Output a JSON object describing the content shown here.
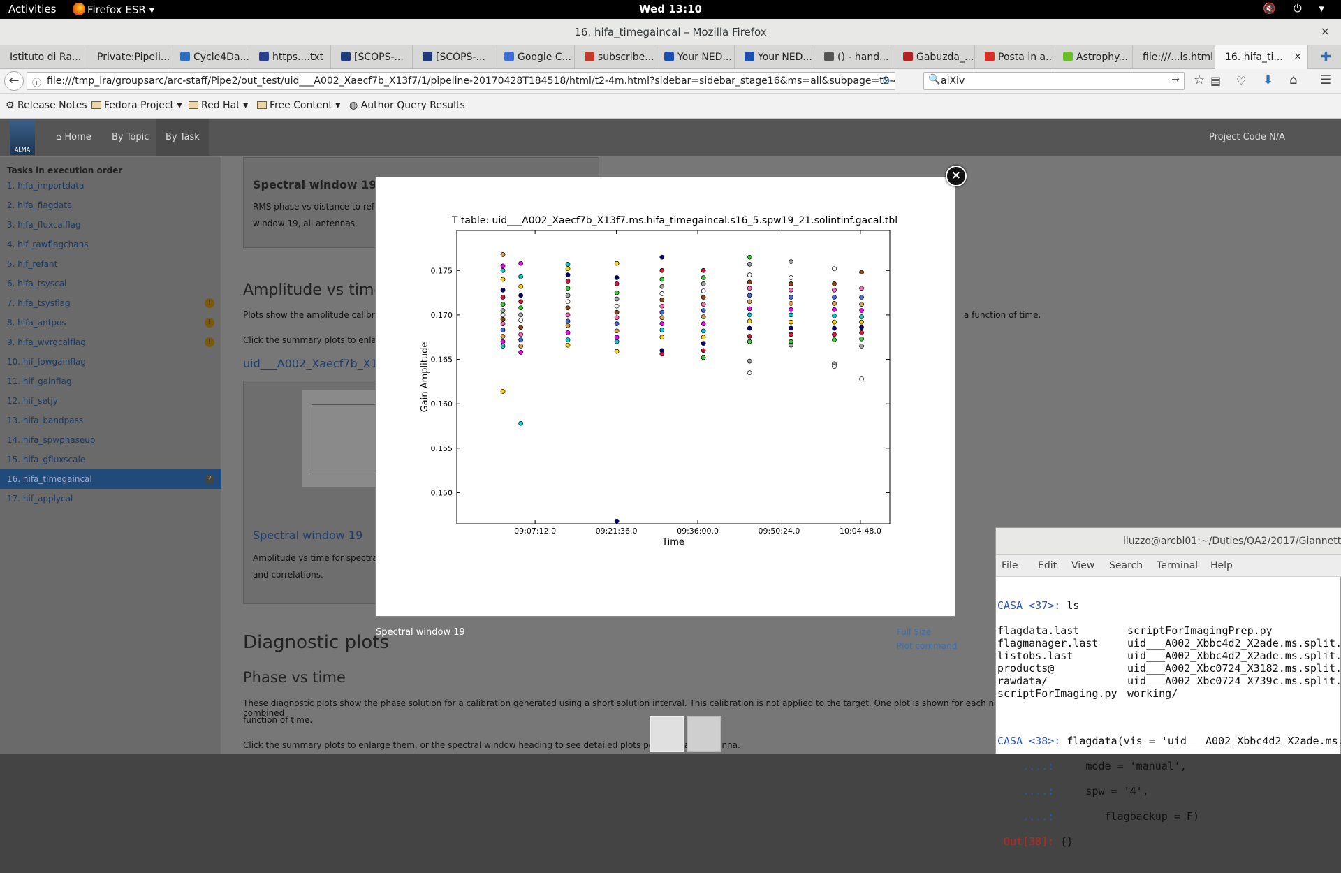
{
  "topbar": {
    "activities": "Activities",
    "app_menu": "Firefox ESR ▾",
    "clock": "Wed 13:10",
    "tray": "🔇 ⏻ ▾"
  },
  "window": {
    "title": "16. hifa_timegaincal – Mozilla Firefox",
    "close": "×"
  },
  "tabs": [
    {
      "label": "Istituto di Ra...",
      "color": ""
    },
    {
      "label": "Private:Pipeli...",
      "color": ""
    },
    {
      "label": "Cycle4Da...",
      "color": "#2a6ebd"
    },
    {
      "label": "https....txt",
      "color": "#2b3f8f"
    },
    {
      "label": "[SCOPS-...",
      "color": "#1f3a7a"
    },
    {
      "label": "[SCOPS-...",
      "color": "#1f3a7a"
    },
    {
      "label": "Google C...",
      "color": "#3b6fd6"
    },
    {
      "label": "subscribe...",
      "color": "#c03b2b"
    },
    {
      "label": "Your NED...",
      "color": "#1a4fb0"
    },
    {
      "label": "Your NED...",
      "color": "#1a4fb0"
    },
    {
      "label": "() - hand...",
      "color": "#555"
    },
    {
      "label": "Gabuzda_...",
      "color": "#b22222"
    },
    {
      "label": "Posta in a...",
      "color": "#d93025"
    },
    {
      "label": "Astrophy...",
      "color": "#6bbf2b"
    },
    {
      "label": "file:///...ls.html",
      "color": ""
    },
    {
      "label": "16. hifa_ti...",
      "color": "",
      "close": "×"
    }
  ],
  "nav": {
    "url": "file:///tmp_ira/groupsarc/arc-staff/Pipe2/out_test/uid___A002_Xaecf7b_X13f7/1/pipeline-20170428T184518/html/t2-4m.html?sidebar=sidebar_stage16&ms=all&subpage=t2-4m_",
    "search_value": "aiXiv"
  },
  "bookmarks": [
    "Release Notes",
    "Fedora Project",
    "Red Hat",
    "Free Content",
    "Author Query Results"
  ],
  "page_nav": {
    "logo": "ALMA",
    "home": "Home",
    "by_topic": "By Topic",
    "by_task": "By Task",
    "project_code": "Project Code N/A"
  },
  "sidebar": {
    "heading": "Tasks in execution order",
    "items": [
      "1. hifa_importdata",
      "2. hifa_flagdata",
      "3. hifa_fluxcalflag",
      "4. hif_rawflagchans",
      "5. hif_refant",
      "6. hifa_tsyscal",
      "7. hifa_tsysflag",
      "8. hifa_antpos",
      "9. hifa_wvrgcalflag",
      "10. hif_lowgainflag",
      "11. hif_gainflag",
      "12. hif_setjy",
      "13. hifa_bandpass",
      "14. hifa_spwphaseup",
      "15. hifa_gfluxscale",
      "16. hifa_timegaincal",
      "17. hif_applycal"
    ]
  },
  "content": {
    "spw_heading_top": "Spectral window 19",
    "spw_desc_top_1": "RMS phase vs distance to refer",
    "spw_desc_top_2": "window 19, all antennas.",
    "amp_heading": "Amplitude vs time",
    "amp_desc": "Plots show the amplitude calibra",
    "amp_desc_right": "a function of time.",
    "amp_click": "Click the summary plots to enlarg",
    "uid_link": "uid___A002_Xaecf7b_X1",
    "spw_link": "Spectral window 19",
    "spw_desc_1": "Amplitude vs time for spectral v",
    "spw_desc_2": "and correlations.",
    "diag_heading": "Diagnostic plots",
    "phase_heading": "Phase vs time",
    "phase_desc_1": "These diagnostic plots show the phase solution for a calibration generated using a short solution interval. This calibration is not applied to the target. One plot is shown for each non-combined",
    "phase_desc_2": "function of time.",
    "phase_click": "Click the summary plots to enlarge them, or the spectral window heading to see detailed plots per spec",
    "phase_click_tail": "and antenna."
  },
  "modal": {
    "close": "×",
    "caption": "Spectral window 19",
    "full_size": "Full Size",
    "plot_command": "Plot command"
  },
  "chart_data": {
    "type": "scatter",
    "title": "T table: uid___A002_Xaecf7b_X13f7.ms.hifa_timegaincal.s16_5.spw19_21.solintinf.gacal.tbl",
    "xlabel": "Time",
    "ylabel": "Gain Amplitude",
    "x_ticks": [
      "09:07:12.0",
      "09:21:36.0",
      "09:36:00.0",
      "09:50:24.0",
      "10:04:48.0"
    ],
    "y_ticks": [
      "0.150",
      "0.155",
      "0.160",
      "0.165",
      "0.170",
      "0.175"
    ],
    "ylim": [
      0.1465,
      0.1795
    ],
    "xlim_seconds": [
      32000,
      36600
    ],
    "grid": false,
    "scan_times": [
      "09:01:30",
      "09:04:40",
      "09:13:00",
      "09:21:40",
      "09:29:40",
      "09:37:00",
      "09:45:10",
      "09:52:30",
      "10:00:10",
      "10:05:00"
    ],
    "marker_colors": [
      "#d4a24a",
      "#ff00ff",
      "#00ced1",
      "#ffd700",
      "#000080",
      "#dc143c",
      "#32cd32",
      "#a0a0a0",
      "#ffffff",
      "#8b4513",
      "#ff69b4",
      "#4169e1"
    ],
    "points": [
      {
        "scan": 0,
        "values": [
          0.1768,
          0.1755,
          0.175,
          0.174,
          0.1728,
          0.172,
          0.1712,
          0.1705,
          0.17,
          0.1695,
          0.169,
          0.1683,
          0.1676,
          0.167,
          0.1665,
          0.1614
        ]
      },
      {
        "scan": 1,
        "values": [
          0.1758,
          0.1743,
          0.1732,
          0.1722,
          0.1715,
          0.1708,
          0.17,
          0.1694,
          0.1686,
          0.1678,
          0.1672,
          0.1665,
          0.1658,
          0.1578
        ]
      },
      {
        "scan": 2,
        "values": [
          0.1757,
          0.1752,
          0.1745,
          0.1738,
          0.173,
          0.1722,
          0.1715,
          0.1708,
          0.17,
          0.1693,
          0.1688,
          0.168,
          0.1672,
          0.1666
        ]
      },
      {
        "scan": 3,
        "values": [
          0.1758,
          0.1742,
          0.1735,
          0.1725,
          0.1718,
          0.171,
          0.1703,
          0.1697,
          0.169,
          0.1682,
          0.1675,
          0.167,
          0.1659,
          0.1468
        ]
      },
      {
        "scan": 4,
        "values": [
          0.1765,
          0.175,
          0.174,
          0.1732,
          0.1724,
          0.1717,
          0.171,
          0.1703,
          0.1697,
          0.169,
          0.1683,
          0.1675,
          0.166,
          0.1656
        ]
      },
      {
        "scan": 5,
        "values": [
          0.175,
          0.1742,
          0.1735,
          0.1727,
          0.172,
          0.1712,
          0.1705,
          0.1698,
          0.169,
          0.1682,
          0.1675,
          0.1668,
          0.166,
          0.1652
        ]
      },
      {
        "scan": 6,
        "values": [
          0.1765,
          0.1757,
          0.1745,
          0.1737,
          0.173,
          0.1722,
          0.1715,
          0.1707,
          0.17,
          0.1693,
          0.1685,
          0.1676,
          0.167,
          0.1648,
          0.1635
        ]
      },
      {
        "scan": 7,
        "values": [
          0.176,
          0.1742,
          0.1735,
          0.1728,
          0.172,
          0.1713,
          0.1706,
          0.17,
          0.1692,
          0.1685,
          0.1678,
          0.167,
          0.1666
        ]
      },
      {
        "scan": 8,
        "values": [
          0.1752,
          0.1735,
          0.1728,
          0.172,
          0.1713,
          0.1706,
          0.1699,
          0.1692,
          0.1685,
          0.1678,
          0.1672,
          0.1645,
          0.1642
        ]
      },
      {
        "scan": 9,
        "values": [
          0.1748,
          0.173,
          0.172,
          0.1712,
          0.1705,
          0.1698,
          0.1692,
          0.1686,
          0.168,
          0.1673,
          0.1665,
          0.1628
        ]
      }
    ]
  },
  "terminal": {
    "title": "liuzzo@arcbl01:~/Duties/QA2/2017/Giannett",
    "menu": [
      "File",
      "Edit",
      "View",
      "Search",
      "Terminal",
      "Help"
    ],
    "prompt37": "CASA <37>:",
    "cmd37": " ls",
    "ls_rows": [
      [
        "flagdata.last",
        "scriptForImagingPrep.py"
      ],
      [
        "flagmanager.last",
        "uid___A002_Xbbc4d2_X2ade.ms.split."
      ],
      [
        "listobs.last",
        "uid___A002_Xbbc4d2_X2ade.ms.split."
      ],
      [
        "products@",
        "uid___A002_Xbc0724_X3182.ms.split."
      ],
      [
        "rawdata/",
        "uid___A002_Xbc0724_X739c.ms.split."
      ],
      [
        "scriptForImaging.py",
        "working/"
      ]
    ],
    "prompt38": "CASA <38>:",
    "cmd38": " flagdata(vis = 'uid___A002_Xbbc4d2_X2ade.ms.",
    "cont": "....:",
    "cont1": "     mode = 'manual',",
    "cont2": "     spw = '4',",
    "cont3": "        flagbackup = F)",
    "out": "Out[38]:",
    "out_val": " {}"
  }
}
